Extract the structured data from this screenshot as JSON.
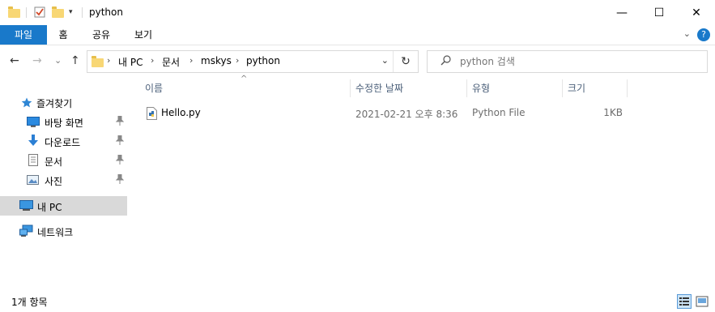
{
  "window": {
    "title": "python",
    "minimize": "—",
    "maximize": "☐",
    "close": "✕"
  },
  "ribbon": {
    "tabs": [
      "파일",
      "홈",
      "공유",
      "보기"
    ],
    "help": "?",
    "expand": "⌄"
  },
  "nav": {
    "back": "←",
    "forward": "→",
    "recent": "⌄",
    "up": "↑",
    "breadcrumb": [
      "내 PC",
      "문서",
      "mskys",
      "python"
    ],
    "crumb_sep": "›",
    "dropdown": "⌄",
    "refresh": "↻"
  },
  "search": {
    "placeholder": "python 검색"
  },
  "sidebar": {
    "items": [
      {
        "label": "즐겨찾기",
        "icon": "star-icon"
      },
      {
        "label": "바탕 화면",
        "icon": "desktop-icon",
        "pinned": true
      },
      {
        "label": "다운로드",
        "icon": "download-icon",
        "pinned": true
      },
      {
        "label": "문서",
        "icon": "document-icon",
        "pinned": true
      },
      {
        "label": "사진",
        "icon": "pictures-icon",
        "pinned": true
      },
      {
        "label": "내 PC",
        "icon": "computer-icon",
        "selected": true
      },
      {
        "label": "네트워크",
        "icon": "network-icon"
      }
    ]
  },
  "columns": [
    "이름",
    "수정한 날짜",
    "유형",
    "크기"
  ],
  "sort_arrow": "^",
  "files": [
    {
      "name": "Hello.py",
      "modified": "2021-02-21 오후 8:36",
      "type": "Python File",
      "size": "1KB",
      "icon": "python-file-icon"
    }
  ],
  "status": {
    "item_count": "1개 항목"
  },
  "colors": {
    "accent": "#1979ca",
    "folder": "#f8d775",
    "selected_bg": "#d9d9d9",
    "header_text": "#4c607a"
  }
}
